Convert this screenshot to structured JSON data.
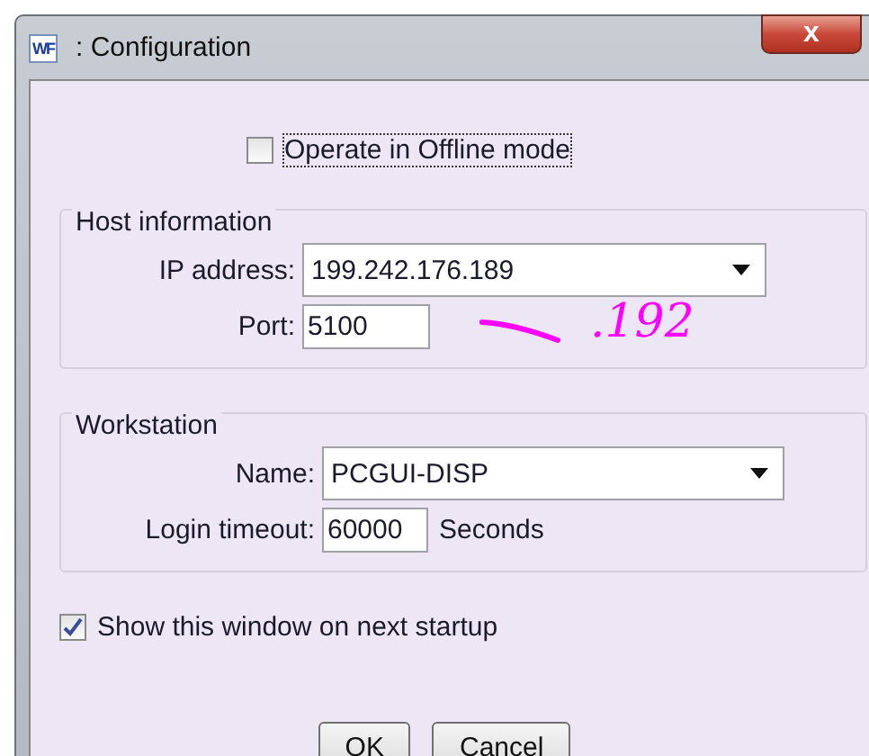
{
  "window": {
    "icon_text": "WF",
    "title": ": Configuration",
    "close": "x"
  },
  "offline_mode": {
    "label": "Operate in Offline mode",
    "checked": false
  },
  "host_information": {
    "title": "Host information",
    "ip_address": {
      "label": "IP address:",
      "value": "199.242.176.189"
    },
    "port": {
      "label": "Port:",
      "value": "5100"
    }
  },
  "annotation": {
    "text": ".192"
  },
  "workstation": {
    "title": "Workstation",
    "name": {
      "label": "Name:",
      "value": "PCGUI-DISP"
    },
    "login_timeout": {
      "label": "Login timeout:",
      "value": "60000",
      "unit": "Seconds"
    }
  },
  "show_on_startup": {
    "label": "Show this window on next startup",
    "checked": true
  },
  "buttons": [
    "OK",
    "Cancel"
  ]
}
